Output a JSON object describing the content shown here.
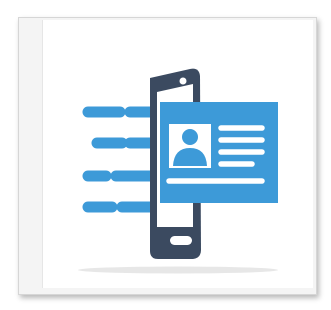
{
  "icon": {
    "semantic": "mobile-id-card-transfer-icon",
    "accent_color": "#3d9ad8",
    "phone_color": "#3b4a60",
    "background_color": "#ffffff"
  }
}
